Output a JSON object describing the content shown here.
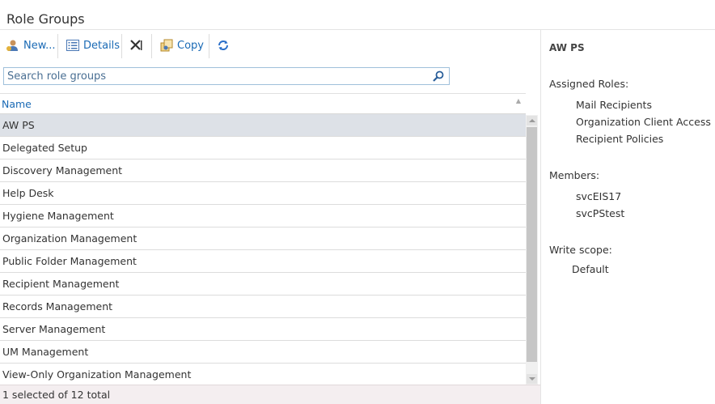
{
  "page_title": "Role Groups",
  "toolbar": {
    "new_label": "New...",
    "details_label": "Details",
    "copy_label": "Copy"
  },
  "search": {
    "placeholder": "Search role groups"
  },
  "list": {
    "column_name": "Name",
    "rows": [
      "AW PS",
      "Delegated Setup",
      "Discovery Management",
      "Help Desk",
      "Hygiene Management",
      "Organization Management",
      "Public Folder Management",
      "Recipient Management",
      "Records Management",
      "Server Management",
      "UM Management",
      "View-Only Organization Management"
    ],
    "selected_index": 0,
    "status": "1 selected of 12 total"
  },
  "details": {
    "title": "AW PS",
    "assigned_roles_label": "Assigned Roles:",
    "assigned_roles": [
      "Mail Recipients",
      "Organization Client Access",
      "Recipient Policies"
    ],
    "members_label": "Members:",
    "members": [
      "svcEIS17",
      "svcPStest"
    ],
    "write_scope_label": "Write scope:",
    "write_scope": "Default"
  },
  "colors": {
    "accent": "#1a6ab5",
    "selected_row": "#dde1e7",
    "status_bar": "#f4eef0"
  }
}
